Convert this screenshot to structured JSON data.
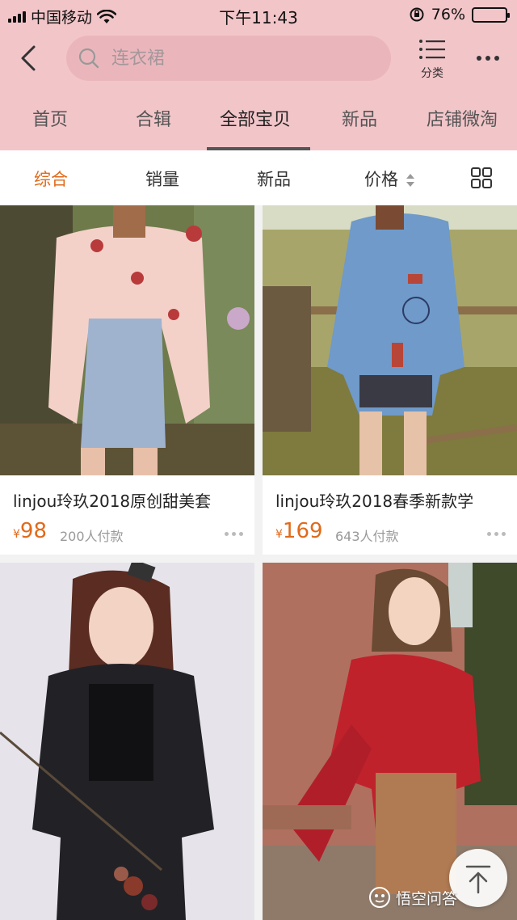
{
  "status_bar": {
    "carrier": "中国移动",
    "time": "下午11:43",
    "battery": "76%",
    "battery_level": 0.76
  },
  "search": {
    "placeholder": "连衣裙"
  },
  "header": {
    "category_label": "分类"
  },
  "tabs": [
    {
      "label": "首页"
    },
    {
      "label": "合辑"
    },
    {
      "label": "全部宝贝"
    },
    {
      "label": "新品"
    },
    {
      "label": "店铺微淘"
    }
  ],
  "sort": {
    "items": [
      "综合",
      "销量",
      "新品",
      "价格"
    ]
  },
  "products": [
    {
      "title": "linjou玲玖2018原创甜美套",
      "currency": "¥",
      "price": "98",
      "sold": "200人付款"
    },
    {
      "title": "linjou玲玖2018春季新款学",
      "currency": "¥",
      "price": "169",
      "sold": "643人付款"
    },
    {
      "title": "",
      "currency": "",
      "price": "",
      "sold": ""
    },
    {
      "title": "",
      "currency": "",
      "price": "",
      "sold": ""
    }
  ],
  "watermark": {
    "text": "悟空问答"
  },
  "colors": {
    "header_bg": "#f2c5c9",
    "accent": "#e06a1a"
  }
}
